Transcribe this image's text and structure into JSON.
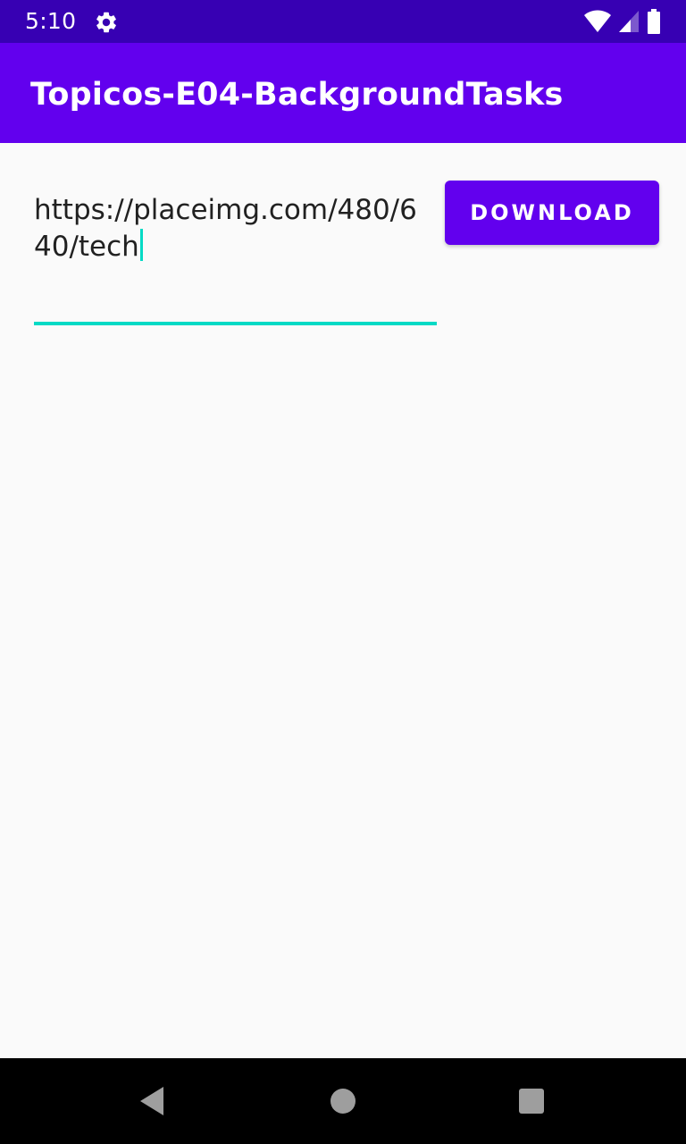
{
  "status_bar": {
    "time": "5:10",
    "icons": [
      "settings-gear-icon",
      "wifi-icon",
      "cellular-signal-icon",
      "battery-icon"
    ],
    "background": "#3700b3"
  },
  "app_bar": {
    "title": "Topicos-E04-BackgroundTasks",
    "background": "#6200ee"
  },
  "url_input": {
    "value": "https://placeimg.com/480/640/tech",
    "accent_color": "#03dac5"
  },
  "download_button": {
    "label": "DOWNLOAD",
    "background": "#6200ee"
  },
  "nav_bar": {
    "buttons": [
      "back-icon",
      "home-icon",
      "recents-icon"
    ]
  }
}
